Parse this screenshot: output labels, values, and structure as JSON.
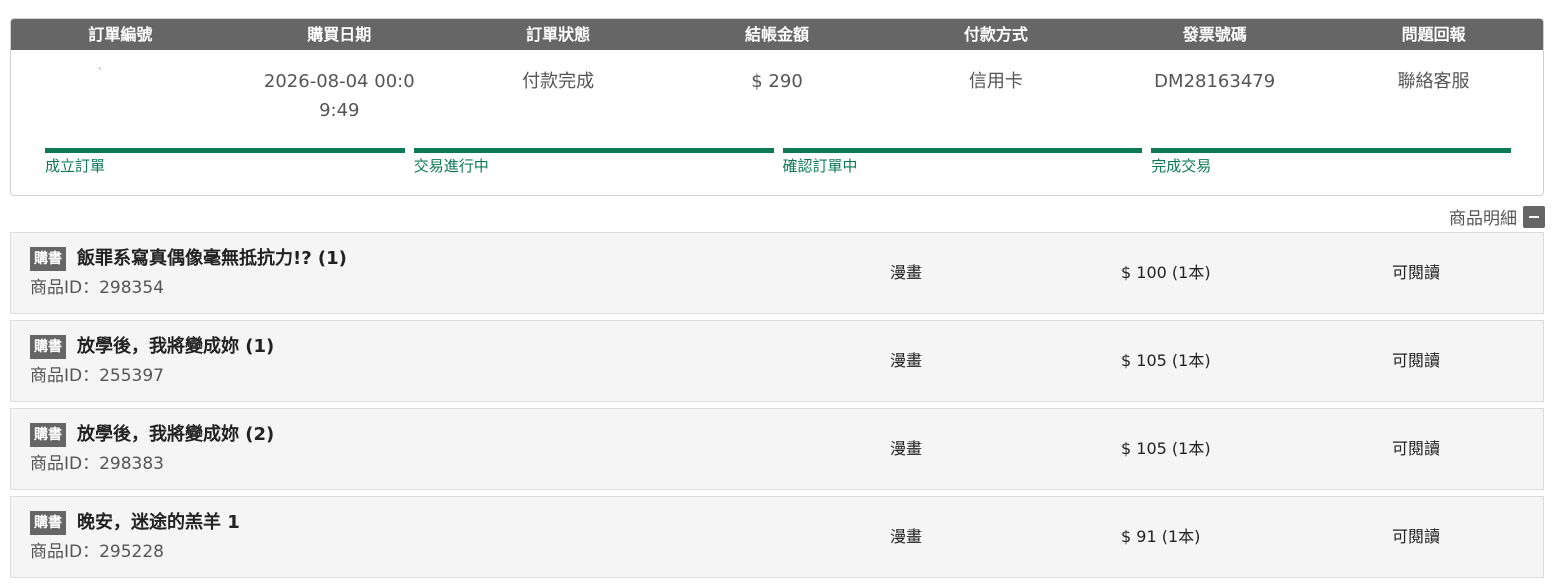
{
  "order_table": {
    "headers": [
      "訂單編號",
      "購買日期",
      "訂單狀態",
      "結帳金額",
      "付款方式",
      "發票號碼",
      "問題回報"
    ],
    "row": {
      "order_id": "`",
      "purchase_date": "2026-08-04 00:09:49",
      "status": "付款完成",
      "amount": "$ 290",
      "payment_method": "信用卡",
      "invoice": "DM28163479",
      "report_link": "聯絡客服"
    },
    "progress_steps": [
      "成立訂單",
      "交易進行中",
      "確認訂單中",
      "完成交易"
    ],
    "accent_color": "#0e7a55"
  },
  "details": {
    "toggle_label": "商品明細"
  },
  "items": [
    {
      "tag": "購書",
      "title": "飯罪系寫真偶像毫無抵抗力!? (1)",
      "product_id": "商品ID：298354",
      "category": "漫畫",
      "price": "$ 100 (1本)",
      "status": "可閱讀"
    },
    {
      "tag": "購書",
      "title": "放學後，我將變成妳 (1)",
      "product_id": "商品ID：255397",
      "category": "漫畫",
      "price": "$ 105 (1本)",
      "status": "可閱讀"
    },
    {
      "tag": "購書",
      "title": "放學後，我將變成妳 (2)",
      "product_id": "商品ID：298383",
      "category": "漫畫",
      "price": "$ 105 (1本)",
      "status": "可閱讀"
    },
    {
      "tag": "購書",
      "title": "晚安，迷途的羔羊 1",
      "product_id": "商品ID：295228",
      "category": "漫畫",
      "price": "$ 91 (1本)",
      "status": "可閱讀"
    }
  ]
}
